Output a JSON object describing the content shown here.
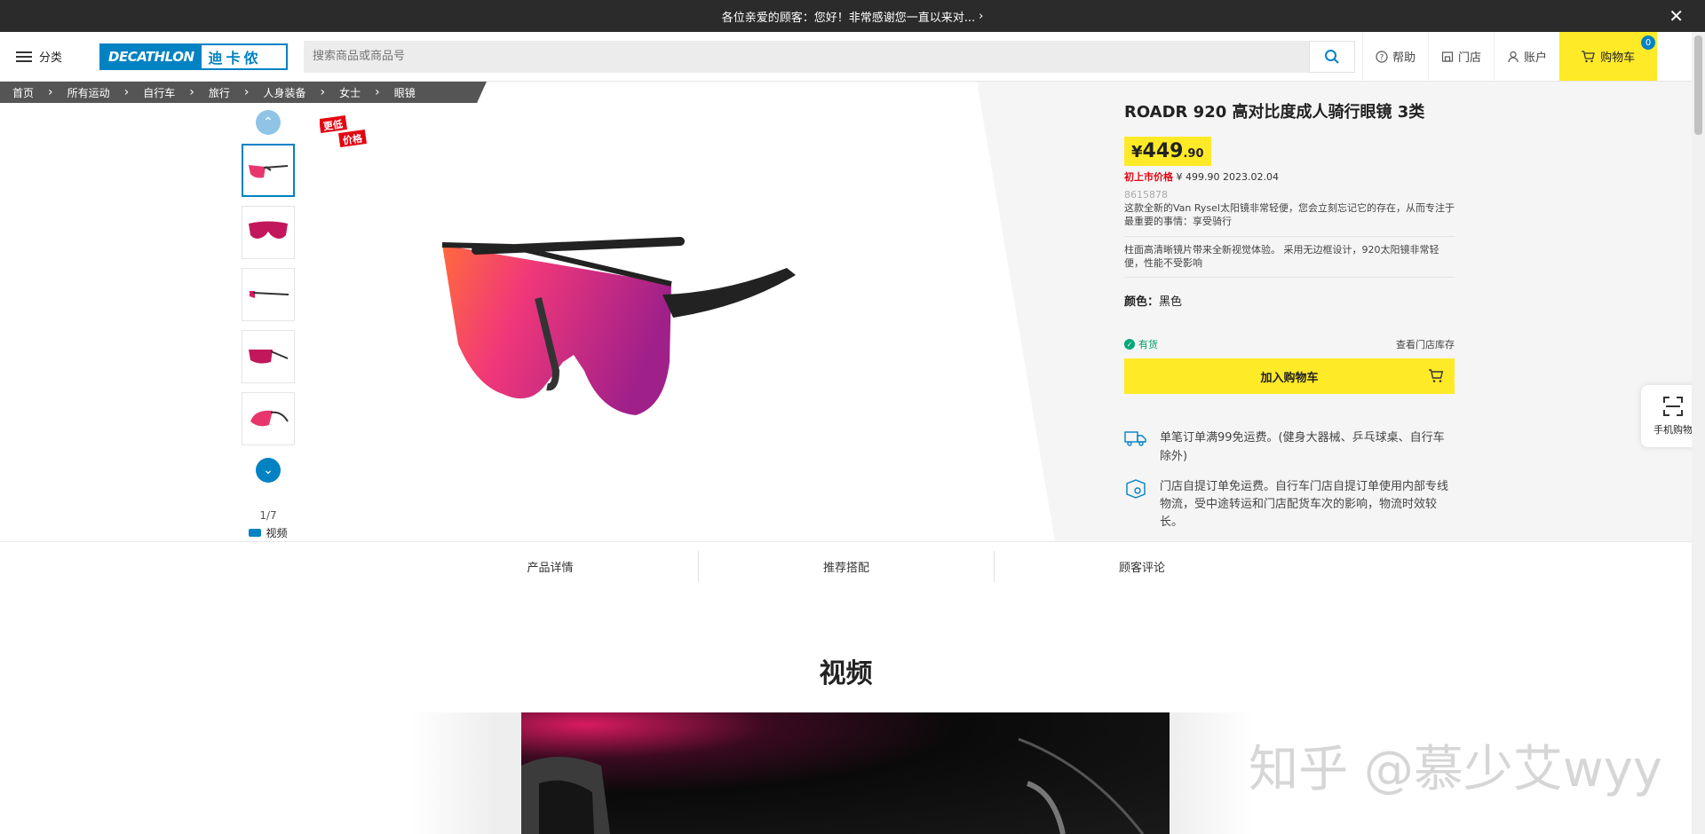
{
  "announcement": {
    "text": "各位亲爱的顾客：您好！非常感谢您一直以来对...",
    "close_glyph": "✕"
  },
  "header": {
    "menu_label": "分类",
    "logo_en": "DECATHLON",
    "logo_cn": "迪卡侬",
    "search_placeholder": "搜索商品或商品号",
    "help": "帮助",
    "store": "门店",
    "account": "账户",
    "cart": "购物车",
    "cart_count": "0"
  },
  "breadcrumb": [
    "首页",
    "所有运动",
    "自行车",
    "旅行",
    "人身装备",
    "女士",
    "眼镜"
  ],
  "gallery": {
    "badge_line1": "更低",
    "badge_line2": "价格",
    "counter": "1/7",
    "video_label": "视频"
  },
  "product": {
    "title": "ROADR 920 高对比度成人骑行眼镜 3类",
    "price_currency": "¥",
    "price_int": "449",
    "price_dec": ".90",
    "orig_label": "初上市价格",
    "orig_value": "¥ 499.90 2023.02.04",
    "sku": "8615878",
    "desc1": "这款全新的Van Rysel太阳镜非常轻便，您会立刻忘记它的存在，从而专注于最重要的事情：享受骑行",
    "desc2": "柱面高清晰镜片带来全新视觉体验。 采用无边框设计，920太阳镜非常轻便，性能不受影响",
    "color_label": "颜色：",
    "color_value": "黑色",
    "stock": "有货",
    "store_stock": "查看门店库存",
    "add_to_cart": "加入购物车",
    "ship1": "单笔订单满99免运费。(健身大器械、乒乓球桌、自行车除外)",
    "ship2": "门店自提订单免运费。自行车门店自提订单使用内部专线物流，受中途转运和门店配货车次的影响，物流时效较长。"
  },
  "mobile_shop": "手机购物",
  "tabs": [
    "产品详情",
    "推荐搭配",
    "顾客评论"
  ],
  "video_section_title": "视频",
  "watermark": "知乎 @慕少艾wyy",
  "colors": {
    "brand_blue": "#0082c3",
    "accent_yellow": "#ffea28",
    "stock_green": "#00a878",
    "price_red": "#e30613"
  }
}
